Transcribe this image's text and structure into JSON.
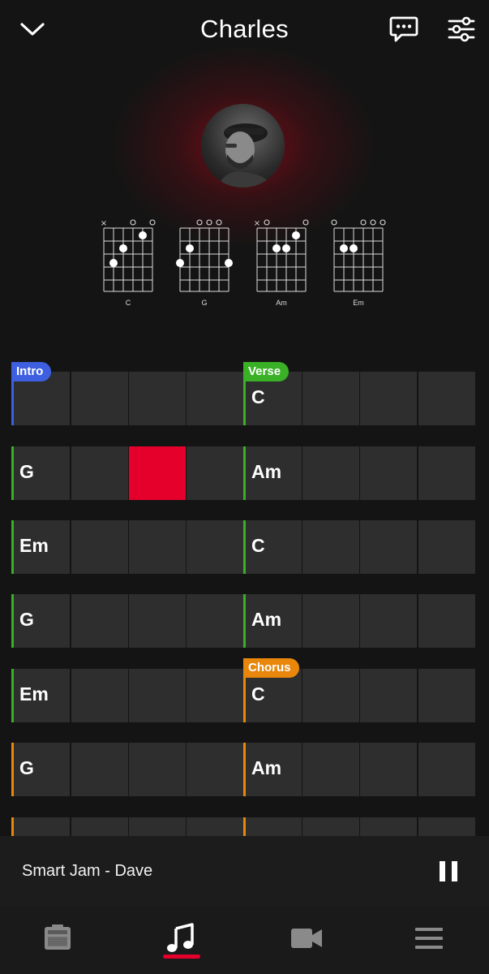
{
  "header": {
    "title": "Charles",
    "icons": [
      "chevron-down-icon",
      "chat-icon",
      "settings-sliders-icon"
    ]
  },
  "chord_diagrams": [
    {
      "name": "C",
      "markers": [
        "x",
        "",
        "",
        "o",
        "",
        "o"
      ]
    },
    {
      "name": "G",
      "markers": [
        "",
        "",
        "",
        "o",
        "o",
        "o"
      ]
    },
    {
      "name": "Am",
      "markers": [
        "x",
        "o",
        "",
        "",
        "",
        "o"
      ]
    },
    {
      "name": "Em",
      "markers": [
        "o",
        "",
        "",
        "o",
        "o",
        "o"
      ]
    }
  ],
  "sections": {
    "intro": {
      "label": "Intro",
      "color": "#3d5fe0"
    },
    "verse": {
      "label": "Verse",
      "color": "#39b026"
    },
    "chorus": {
      "label": "Chorus",
      "color": "#e8870c"
    }
  },
  "grid_rows": [
    {
      "left_chord": "",
      "right_chord": "C",
      "left_color": "#3d5fe0",
      "right_color": "#39b026",
      "left_tag": "Intro",
      "right_tag": "Verse"
    },
    {
      "left_chord": "G",
      "right_chord": "Am",
      "left_color": "#39b026",
      "right_color": "#39b026",
      "highlight_cell": 2
    },
    {
      "left_chord": "Em",
      "right_chord": "C",
      "left_color": "#39b026",
      "right_color": "#39b026"
    },
    {
      "left_chord": "G",
      "right_chord": "Am",
      "left_color": "#39b026",
      "right_color": "#39b026"
    },
    {
      "left_chord": "Em",
      "right_chord": "C",
      "left_color": "#39b026",
      "right_color": "#e8870c",
      "right_tag": "Chorus"
    },
    {
      "left_chord": "G",
      "right_chord": "Am",
      "left_color": "#e8870c",
      "right_color": "#e8870c"
    },
    {
      "left_chord": "",
      "right_chord": "",
      "left_color": "#e8870c",
      "right_color": "#e8870c"
    }
  ],
  "player": {
    "title": "Smart Jam - Dave",
    "state": "playing"
  },
  "nav": {
    "items": [
      "amp-icon",
      "music-note-icon",
      "video-camera-icon",
      "menu-icon"
    ],
    "active": "music-note-icon"
  },
  "colors": {
    "accent": "#e4002b",
    "cell": "#2e2e2e",
    "background": "#141414"
  }
}
